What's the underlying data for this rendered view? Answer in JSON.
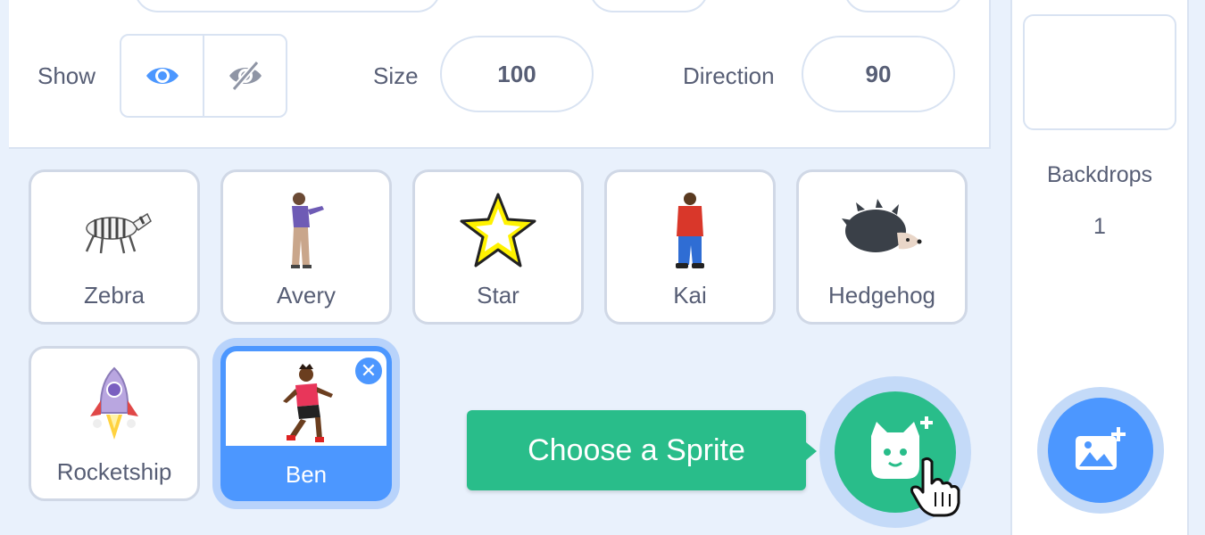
{
  "sprite_info": {
    "show_label": "Show",
    "size_label": "Size",
    "size_value": "100",
    "direction_label": "Direction",
    "direction_value": "90"
  },
  "sprites": [
    {
      "name": "Zebra"
    },
    {
      "name": "Avery"
    },
    {
      "name": "Star"
    },
    {
      "name": "Kai"
    },
    {
      "name": "Hedgehog"
    },
    {
      "name": "Rocketship"
    },
    {
      "name": "Ben",
      "selected": true
    }
  ],
  "tooltip": {
    "text": "Choose a Sprite"
  },
  "stage": {
    "backdrops_label": "Backdrops",
    "backdrops_count": "1"
  },
  "colors": {
    "accent_blue": "#4c97ff",
    "green": "#29bd8a",
    "panel_bg": "#e9f1fc",
    "text": "#575e75"
  }
}
